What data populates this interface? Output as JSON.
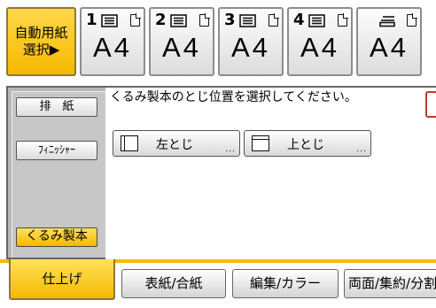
{
  "auto_select": {
    "line1": "自動用紙",
    "line2": "選択▶"
  },
  "trays": [
    {
      "num": "1",
      "size": "A4",
      "icon": "paper-stack-icon"
    },
    {
      "num": "2",
      "size": "A4",
      "icon": "paper-stack-icon"
    },
    {
      "num": "3",
      "size": "A4",
      "icon": "paper-stack-icon"
    },
    {
      "num": "4",
      "size": "A4",
      "icon": "paper-stack-icon"
    },
    {
      "num": "",
      "size": "A4",
      "icon": "bypass-tray-icon"
    }
  ],
  "side_menu": {
    "output": "排　紙",
    "finisher": "ﾌｨﾆｯｼｬｰ",
    "booklet": "くるみ製本"
  },
  "content": {
    "instruction": "くるみ製本のとじ位置を選択してください。",
    "options": [
      {
        "label": "左とじ",
        "icon": "left-binding-icon"
      },
      {
        "label": "上とじ",
        "icon": "top-binding-icon"
      }
    ],
    "more_indicator": "..."
  },
  "tabs": [
    "仕上げ",
    "表紙/合紙",
    "編集/カラー",
    "両面/集約/分割"
  ],
  "colors": {
    "accent": "#f5b800",
    "button_bg": "#dcdcdc",
    "border": "#666666"
  }
}
